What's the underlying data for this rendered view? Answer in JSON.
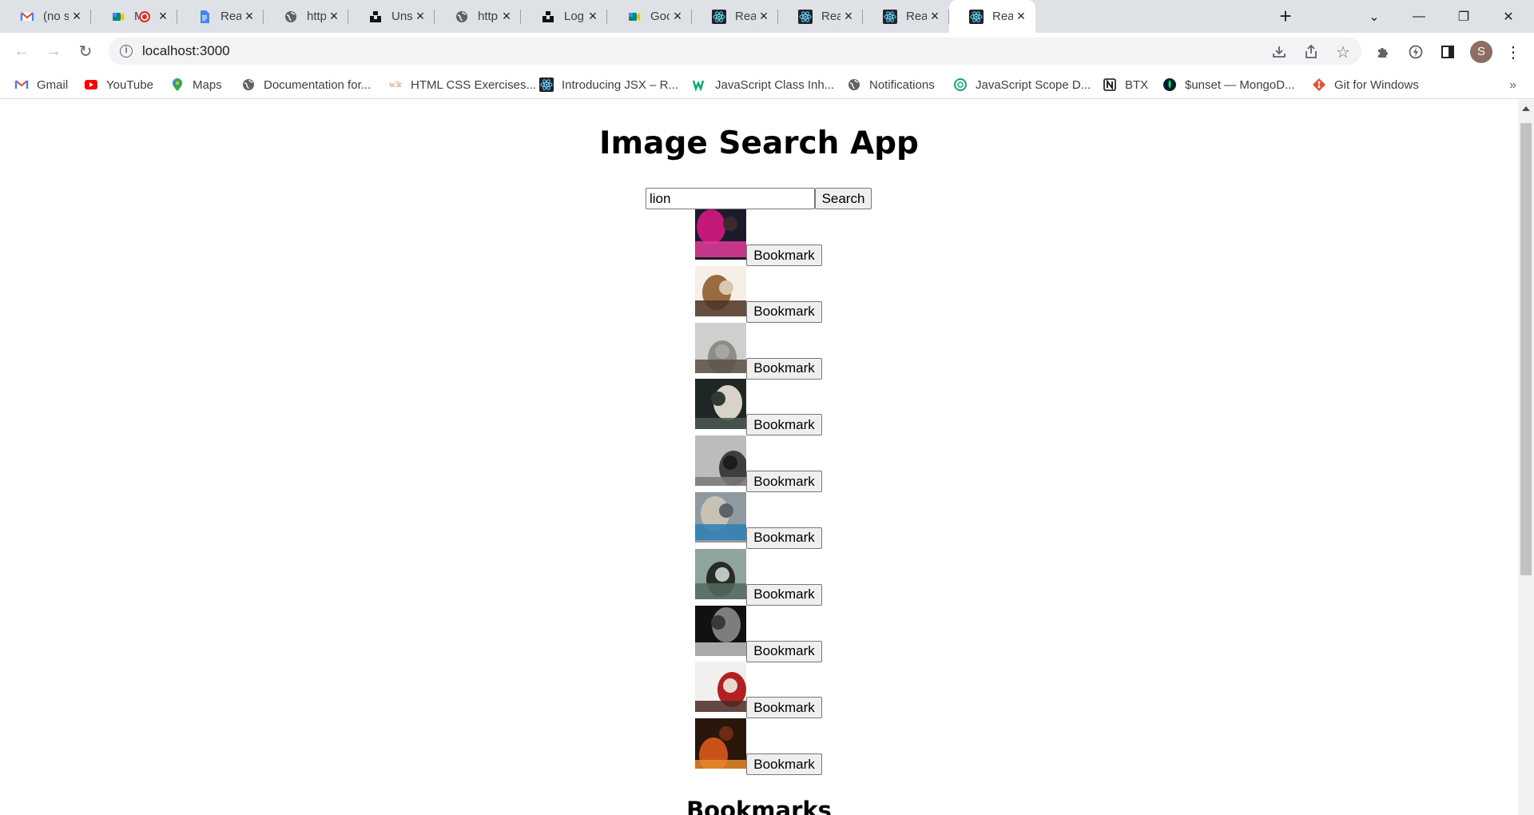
{
  "browser": {
    "tabs": [
      {
        "title": "(no subject)",
        "favicon": "gmail-icon"
      },
      {
        "title": "Meet",
        "favicon": "meet-icon",
        "recording": true
      },
      {
        "title": "React - Google Docs",
        "favicon": "docs-icon"
      },
      {
        "title": "https://",
        "favicon": "globe-icon"
      },
      {
        "title": "Unsplash",
        "favicon": "unsplash-icon"
      },
      {
        "title": "https://",
        "favicon": "globe-icon"
      },
      {
        "title": "Login | Unsplash",
        "favicon": "unsplash-icon"
      },
      {
        "title": "Google Meet",
        "favicon": "meet-icon"
      },
      {
        "title": "React App",
        "favicon": "react-icon"
      },
      {
        "title": "React App",
        "favicon": "react-icon"
      },
      {
        "title": "React App",
        "favicon": "react-icon"
      },
      {
        "title": "React App",
        "favicon": "react-icon",
        "active": true
      }
    ],
    "profile_initial": "S",
    "address": "localhost:3000"
  },
  "bookmarks_bar": [
    {
      "label": "Gmail",
      "icon": "gmail-icon"
    },
    {
      "label": "YouTube",
      "icon": "youtube-icon"
    },
    {
      "label": "Maps",
      "icon": "maps-icon"
    },
    {
      "label": "Documentation for...",
      "icon": "globe-icon"
    },
    {
      "label": "HTML CSS Exercises...",
      "icon": "w3r-icon"
    },
    {
      "label": "Introducing JSX – R...",
      "icon": "react-icon"
    },
    {
      "label": "JavaScript Class Inh...",
      "icon": "w3-icon"
    },
    {
      "label": "Notifications",
      "icon": "globe-icon"
    },
    {
      "label": "JavaScript Scope D...",
      "icon": "openai-icon"
    },
    {
      "label": "BTX",
      "icon": "notion-icon"
    },
    {
      "label": "$unset — MongoD...",
      "icon": "mongodb-icon"
    },
    {
      "label": "Git for Windows",
      "icon": "git-icon"
    }
  ],
  "page": {
    "title": "Image Search App",
    "search": {
      "value": "lion",
      "button_label": "Search"
    },
    "results": [
      {
        "bookmark_label": "Bookmark",
        "palette": [
          "#1b1b2b",
          "#c2187a",
          "#e23b9a",
          "#3a2a30"
        ]
      },
      {
        "bookmark_label": "Bookmark",
        "palette": [
          "#f5efe8",
          "#9a6a40",
          "#4a3322",
          "#d9c8b0"
        ]
      },
      {
        "bookmark_label": "Bookmark",
        "palette": [
          "#cfcfcd",
          "#8e8c88",
          "#5a5147",
          "#a9a6a0"
        ]
      },
      {
        "bookmark_label": "Bookmark",
        "palette": [
          "#1f2624",
          "#d8d2c8",
          "#4b5a52",
          "#2e3a36"
        ]
      },
      {
        "bookmark_label": "Bookmark",
        "palette": [
          "#bcbcbc",
          "#3e3e3e",
          "#7a7a7a",
          "#1c1c1c"
        ]
      },
      {
        "bookmark_label": "Bookmark",
        "palette": [
          "#8e9aa0",
          "#c8c2b4",
          "#2f7fb5",
          "#5b636a"
        ]
      },
      {
        "bookmark_label": "Bookmark",
        "palette": [
          "#8fa49a",
          "#2a2a2a",
          "#556b5e",
          "#b9c7c0"
        ]
      },
      {
        "bookmark_label": "Bookmark",
        "palette": [
          "#111111",
          "#7d7d7d",
          "#c4c4c4",
          "#3a3a3a"
        ]
      },
      {
        "bookmark_label": "Bookmark",
        "palette": [
          "#f2f0ee",
          "#b22024",
          "#4a2a22",
          "#e6d8cc"
        ]
      },
      {
        "bookmark_label": "Bookmark",
        "palette": [
          "#2b160c",
          "#c9521a",
          "#e8892b",
          "#6b2c12"
        ]
      }
    ],
    "bookmarks_heading": "Bookmarks"
  }
}
